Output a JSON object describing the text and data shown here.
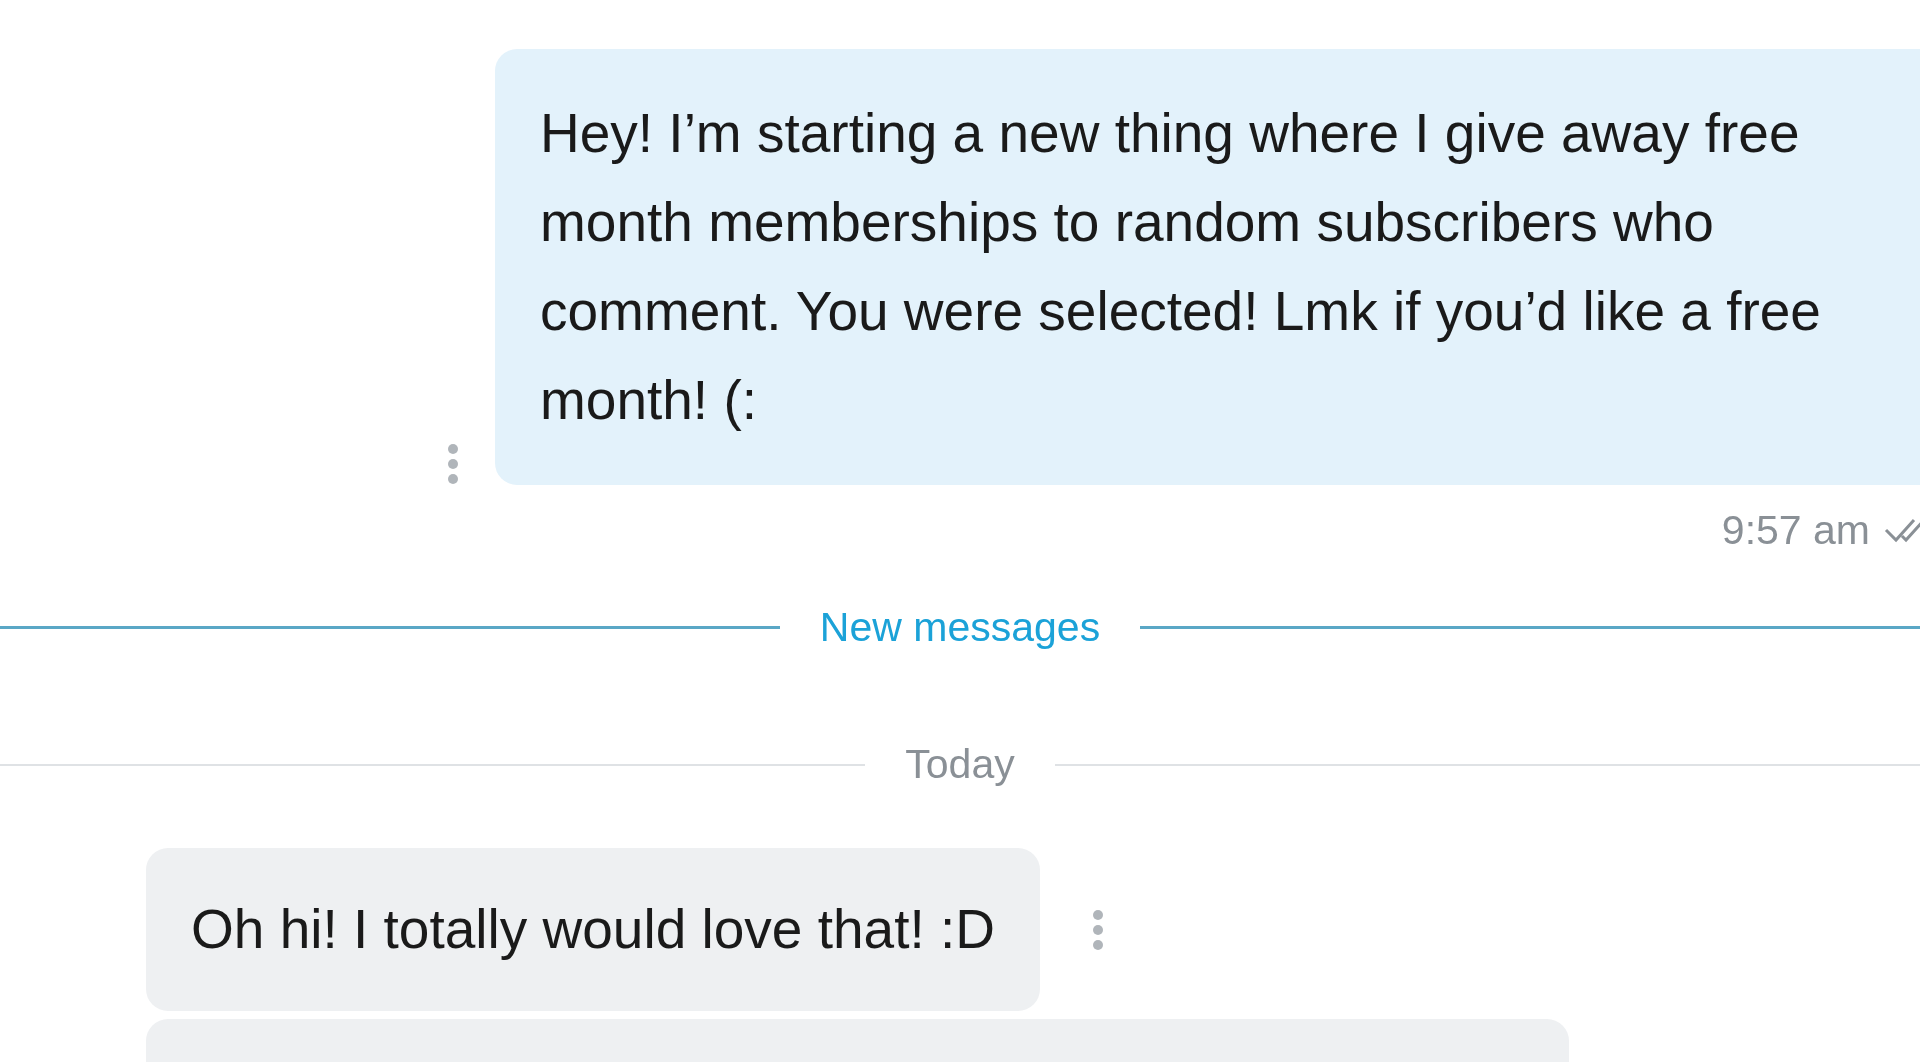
{
  "conversation": [
    {
      "kind": "sent",
      "text": "Hey! I’m starting a new thing where I give away free month memberships to random subscribers who comment. You were selected! Lmk if you’d like a free month! (:",
      "time": "9:57 am"
    },
    {
      "kind": "new_divider",
      "label": "New messages"
    },
    {
      "kind": "date_divider",
      "label": "Today"
    },
    {
      "kind": "received",
      "text": "Oh hi! I totally would love that! :D"
    },
    {
      "kind": "received_partial"
    }
  ]
}
